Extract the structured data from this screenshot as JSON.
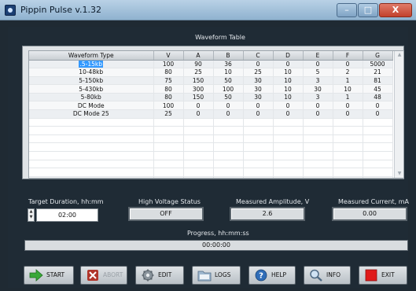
{
  "window": {
    "title": "Pippin Pulse v.1.32",
    "controls": [
      "–",
      "□",
      "X"
    ]
  },
  "waveform_table": {
    "title": "Waveform Table",
    "columns": [
      "Waveform Type",
      "V",
      "A",
      "B",
      "C",
      "D",
      "E",
      "F",
      "G"
    ],
    "rows": [
      [
        ".5-15kb",
        "100",
        "90",
        "36",
        "0",
        "0",
        "0",
        "0",
        "5000"
      ],
      [
        "10-48kb",
        "80",
        "25",
        "10",
        "25",
        "10",
        "5",
        "2",
        "21"
      ],
      [
        "5-150kb",
        "75",
        "150",
        "50",
        "30",
        "10",
        "3",
        "1",
        "81"
      ],
      [
        "5-430kb",
        "80",
        "300",
        "100",
        "30",
        "10",
        "30",
        "10",
        "45"
      ],
      [
        "5-80kb",
        "80",
        "150",
        "50",
        "30",
        "10",
        "3",
        "1",
        "48"
      ],
      [
        "DC Mode",
        "100",
        "0",
        "0",
        "0",
        "0",
        "0",
        "0",
        "0"
      ],
      [
        "DC Mode 25",
        "25",
        "0",
        "0",
        "0",
        "0",
        "0",
        "0",
        "0"
      ]
    ],
    "empty_rows": 8
  },
  "target_duration": {
    "label": "Target Duration, hh:mm",
    "value": "02:00"
  },
  "high_voltage": {
    "label": "High Voltage Status",
    "value": "OFF"
  },
  "amplitude": {
    "label": "Measured Amplitude, V",
    "value": "2.6"
  },
  "current": {
    "label": "Measured Current, mA",
    "value": "0.00"
  },
  "progress": {
    "label": "Progress, hh:mm:ss",
    "value": "00:00:00"
  },
  "buttons": {
    "start": "START",
    "abort": "ABORT",
    "edit": "EDIT",
    "logs": "LOGS",
    "help": "HELP",
    "info": "INFO",
    "exit": "EXIT"
  },
  "colors": {
    "background": "#1f2b35",
    "start": "#38a838",
    "abort": "#b0352a",
    "exit": "#e01a1a",
    "help": "#2f6db8"
  }
}
